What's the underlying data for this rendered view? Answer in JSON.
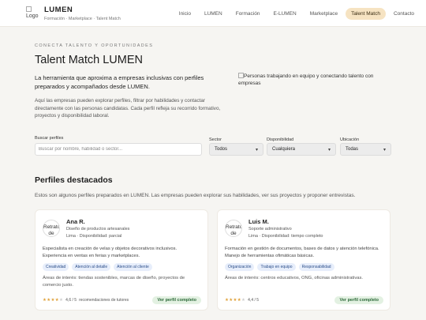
{
  "header": {
    "logo_alt": "Logo",
    "brand": "LUMEN",
    "brand_sub": "Formación · Marketplace · Talent Match",
    "nav": [
      "Inicio",
      "LUMEN",
      "Formación",
      "E-LUMEN",
      "Marketplace",
      "Talent Match",
      "Contacto"
    ],
    "active_nav": "Talent Match"
  },
  "hero": {
    "eyebrow": "CONECTA TALENTO Y OPORTUNIDADES",
    "title": "Talent Match LUMEN",
    "lead": "La herramienta que aproxima a empresas inclusivas con perfiles preparados y acompañados desde LUMEN.",
    "body": "Aquí las empresas pueden explorar perfiles, filtrar por habilidades y contactar directamente con las personas candidatas. Cada perfil refleja su recorrido formativo, proyectos y disponibilidad laboral.",
    "image_alt": "Personas trabajando en equipo y conectando talento con empresas"
  },
  "filters": {
    "search_label": "Buscar perfiles",
    "search_placeholder": "Buscar por nombre, habilidad o sector...",
    "sector_label": "Sector",
    "sector_value": "Todos",
    "availability_label": "Disponibilidad",
    "availability_value": "Cualquiera",
    "location_label": "Ubicación",
    "location_value": "Todas"
  },
  "profiles": {
    "title": "Perfiles destacados",
    "description": "Estos son algunos perfiles preparados en LUMEN. Las empresas pueden explorar sus habilidades, ver sus proyectos y proponer entrevistas.",
    "cards": [
      {
        "avatar_alt": "Retrato de Ana",
        "name": "Ana R.",
        "role": "Diseño de productos artesanales",
        "meta": "Lima · Disponibilidad: parcial",
        "description": "Especialista en creación de velas y objetos decorativos inclusivos. Experiencia en ventas en ferias y marketplaces.",
        "tags": [
          "Creatividad",
          "Atención al detalle",
          "Atención al cliente"
        ],
        "interests": "Áreas de interés: tiendas sostenibles, marcas de diseño, proyectos de comercio justo.",
        "rating": 4.6,
        "rating_text": "4,6 / 5",
        "reviews": "recomendaciones de tutores",
        "button": "Ver perfil completo"
      },
      {
        "avatar_alt": "Retrato de Luis",
        "name": "Luis M.",
        "role": "Soporte administrativo",
        "meta": "Lima · Disponibilidad: tiempo completo",
        "description": "Formación en gestión de documentos, bases de datos y atención telefónica. Manejo de herramientas ofimáticas básicas.",
        "tags": [
          "Organización",
          "Trabajo en equipo",
          "Responsabilidad"
        ],
        "interests": "Áreas de interés: centros educativos, ONG, oficinas administrativas.",
        "rating": 4.4,
        "rating_text": "4,4 / 5",
        "reviews": "",
        "button": "Ver perfil completo"
      }
    ]
  },
  "colors": {
    "accent_nav": "#f6e3c2",
    "tag_bg": "#e7eefb",
    "button_bg": "#e3f1e2",
    "star": "#e0a23b"
  }
}
